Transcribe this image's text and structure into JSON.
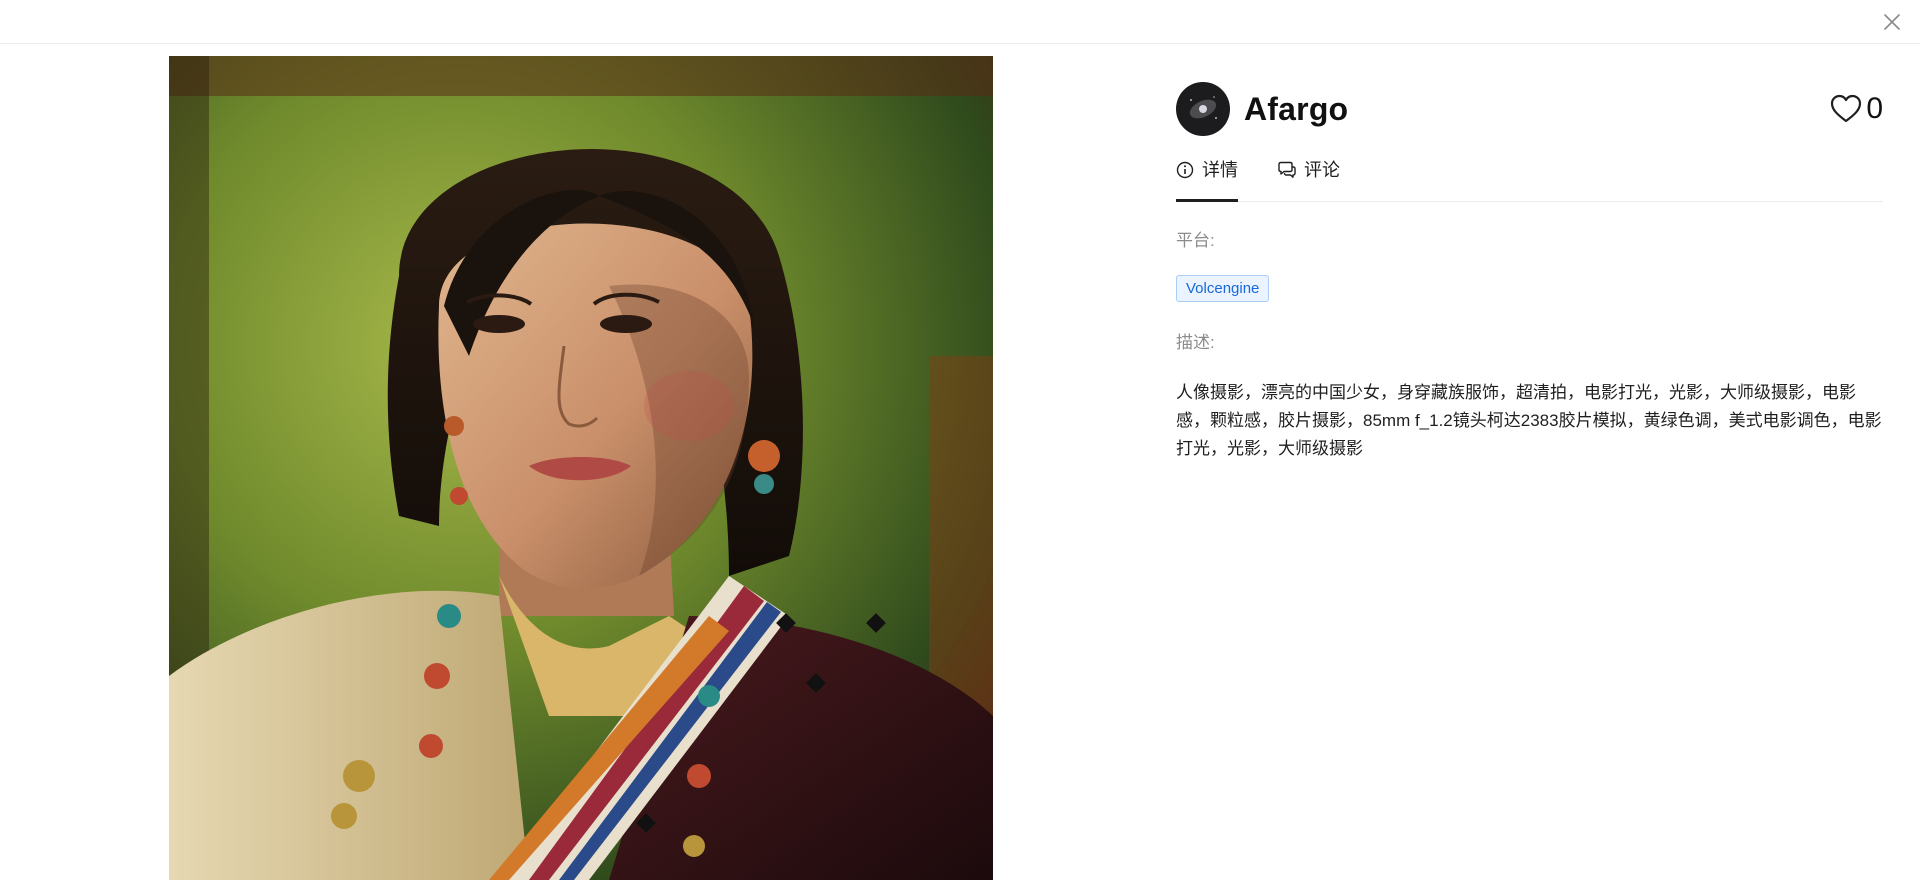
{
  "author": {
    "name": "Afargo",
    "avatar_icon": "avatar-galaxy"
  },
  "like": {
    "icon": "heart-icon",
    "count": "0"
  },
  "tabs": [
    {
      "label": "详情",
      "icon": "info-icon",
      "active": true
    },
    {
      "label": "评论",
      "icon": "comment-icon",
      "active": false
    }
  ],
  "details": {
    "platform_label": "平台:",
    "platform_tag": "Volcengine",
    "description_label": "描述:",
    "description": "人像摄影，漂亮的中国少女，身穿藏族服饰，超清拍，电影打光，光影，大师级摄影，电影感，颗粒感，胶片摄影，85mm f_1.2镜头柯达2383胶片模拟，黄绿色调，美式电影调色，电影打光，光影，大师级摄影"
  },
  "colors": {
    "tag_text": "#1769d6",
    "tag_bg": "#eaf3ff",
    "tag_border": "#a9cdf5"
  }
}
